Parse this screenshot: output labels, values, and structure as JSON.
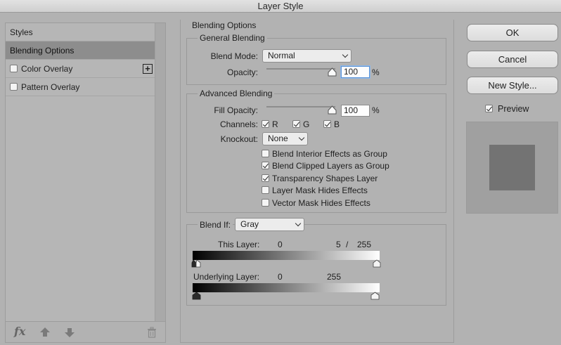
{
  "window": {
    "title": "Layer Style"
  },
  "styles": {
    "items": [
      {
        "label": "Styles"
      },
      {
        "label": "Blending Options"
      },
      {
        "label": "Color Overlay"
      },
      {
        "label": "Pattern Overlay"
      }
    ],
    "add_symbol": "+",
    "bottom_bar": {
      "fx_label": "fx"
    }
  },
  "blending": {
    "title": "Blending Options",
    "general": {
      "title": "General Blending",
      "blend_mode_label": "Blend Mode:",
      "blend_mode_value": "Normal",
      "opacity_label": "Opacity:",
      "opacity_value": "100",
      "opacity_unit": "%",
      "opacity_level": 1.0
    },
    "advanced": {
      "title": "Advanced Blending",
      "fill_opacity_label": "Fill Opacity:",
      "fill_opacity_value": "100",
      "fill_opacity_unit": "%",
      "fill_opacity_level": 1.0,
      "channels_label": "Channels:",
      "channels": [
        {
          "label": "R",
          "checked": true
        },
        {
          "label": "G",
          "checked": true
        },
        {
          "label": "B",
          "checked": true
        }
      ],
      "knockout_label": "Knockout:",
      "knockout_value": "None",
      "options": [
        {
          "label": "Blend Interior Effects as Group",
          "checked": false
        },
        {
          "label": "Blend Clipped Layers as Group",
          "checked": true
        },
        {
          "label": "Transparency Shapes Layer",
          "checked": true
        },
        {
          "label": "Layer Mask Hides Effects",
          "checked": false
        },
        {
          "label": "Vector Mask Hides Effects",
          "checked": false
        }
      ]
    },
    "blend_if": {
      "label": "Blend If:",
      "value": "Gray",
      "this_layer": {
        "label": "This Layer:",
        "low": "0",
        "high_a": "5",
        "separator": "/",
        "high_b": "255"
      },
      "underlying_layer": {
        "label": "Underlying Layer:",
        "low": "0",
        "high": "255"
      }
    }
  },
  "actions": {
    "ok_label": "OK",
    "cancel_label": "Cancel",
    "new_style_label": "New Style...",
    "preview_label": "Preview",
    "preview_checked": true
  }
}
